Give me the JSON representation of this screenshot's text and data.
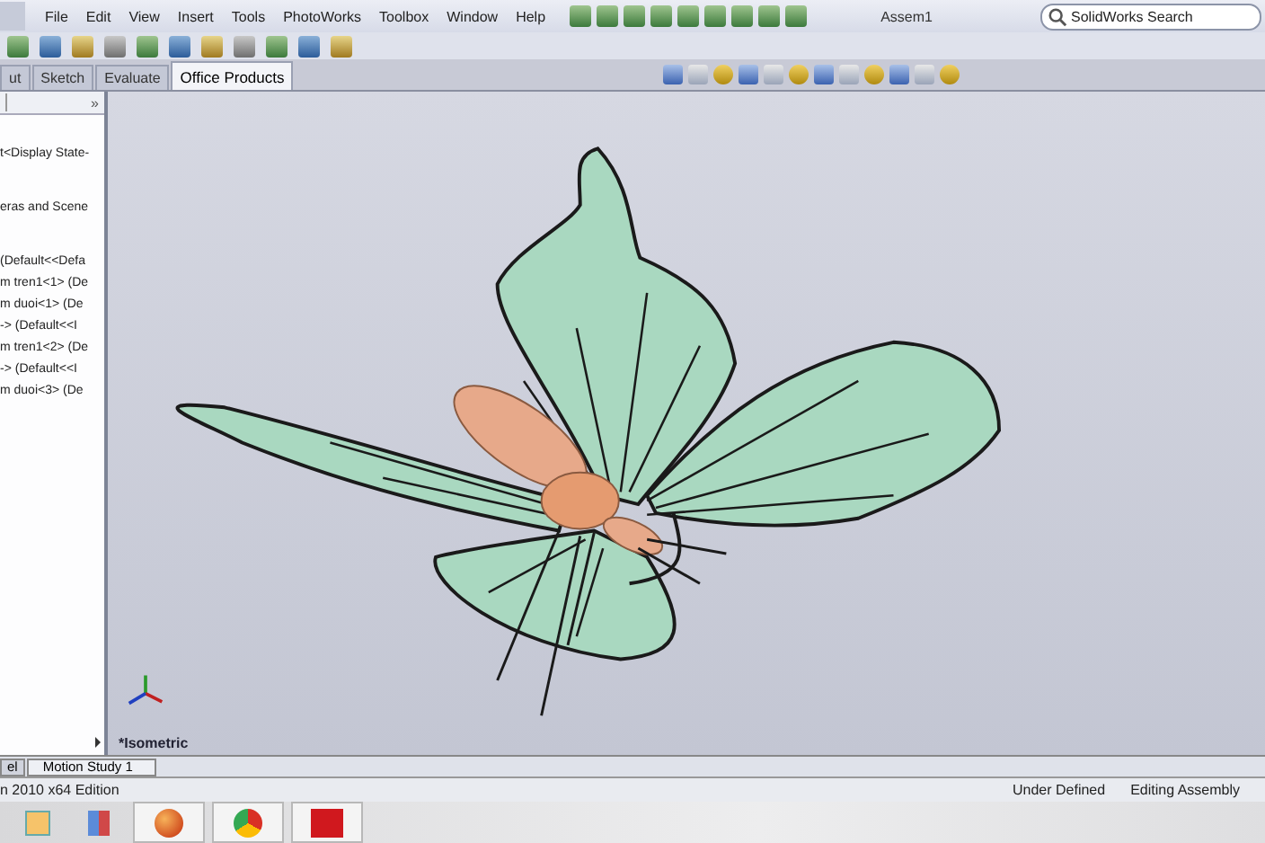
{
  "menu": [
    "File",
    "Edit",
    "View",
    "Insert",
    "Tools",
    "PhotoWorks",
    "Toolbox",
    "Window",
    "Help"
  ],
  "window": {
    "title": "Assem1"
  },
  "search": {
    "placeholder": "SolidWorks Search"
  },
  "tabs": [
    {
      "label": "ut",
      "selected": false
    },
    {
      "label": "Sketch",
      "selected": false
    },
    {
      "label": "Evaluate",
      "selected": false
    },
    {
      "label": "Office Products",
      "selected": true
    }
  ],
  "panel": {
    "collapse": "»"
  },
  "tree": [
    {
      "label": "t<Display State-",
      "kind": "item"
    },
    {
      "label": "eras and Scene",
      "kind": "spaced"
    },
    {
      "label": "(Default<<Defa",
      "kind": "spaced"
    },
    {
      "label": "m tren1<1> (De",
      "kind": "item"
    },
    {
      "label": "m duoi<1> (De",
      "kind": "item"
    },
    {
      "label": "-> (Default<<I",
      "kind": "item"
    },
    {
      "label": "m tren1<2> (De",
      "kind": "item"
    },
    {
      "label": "-> (Default<<I",
      "kind": "item"
    },
    {
      "label": "m duoi<3> (De",
      "kind": "item"
    }
  ],
  "viewport": {
    "view_name": "*Isometric"
  },
  "bottom_tabs": [
    {
      "label": "el",
      "selected": false
    },
    {
      "label": "Motion Study 1",
      "selected": true
    }
  ],
  "status_bar": {
    "edition": "n 2010 x64 Edition",
    "state": "Under Defined",
    "mode": "Editing Assembly"
  }
}
